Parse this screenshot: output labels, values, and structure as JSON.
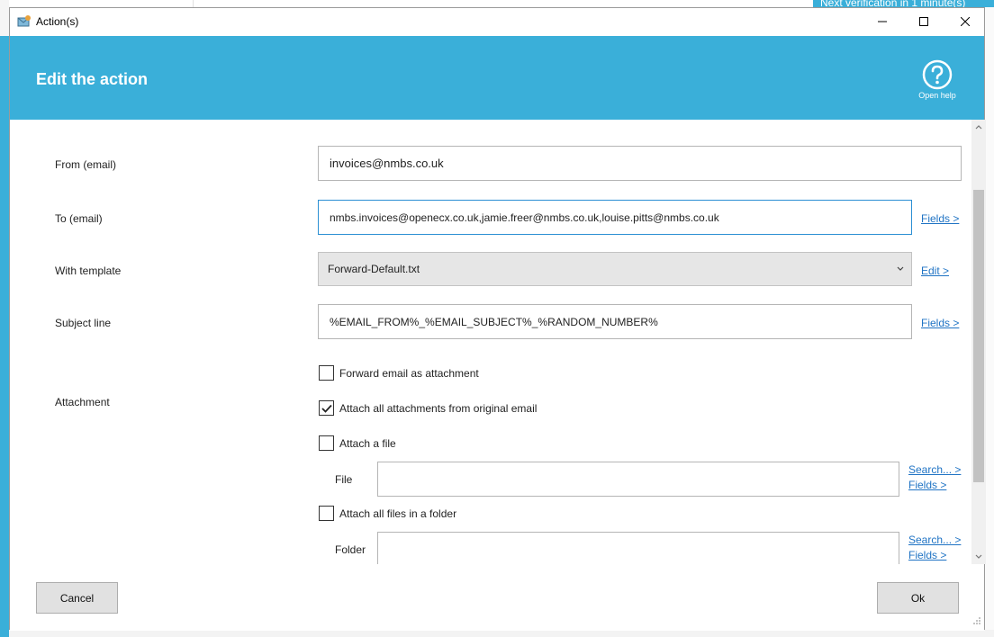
{
  "window": {
    "title": "Action(s)"
  },
  "background": {
    "banner_text": "Next verification in 1 minute(s)"
  },
  "header": {
    "heading": "Edit the action",
    "help_label": "Open help"
  },
  "form": {
    "from_label": "From (email)",
    "from_value": "invoices@nmbs.co.uk",
    "to_label": "To (email)",
    "to_value": "nmbs.invoices@openecx.co.uk,jamie.freer@nmbs.co.uk,louise.pitts@nmbs.co.uk",
    "to_link": "Fields >",
    "template_label": "With template",
    "template_value": "Forward-Default.txt",
    "template_link": "Edit >",
    "subject_label": "Subject line",
    "subject_value": "%EMAIL_FROM%_%EMAIL_SUBJECT%_%RANDOM_NUMBER%",
    "subject_link": "Fields >",
    "attachment_label": "Attachment",
    "forward_as_attachment": {
      "label": "Forward email as attachment",
      "checked": false
    },
    "attach_all_original": {
      "label": "Attach all attachments from original email",
      "checked": true
    },
    "attach_file": {
      "label": "Attach a file",
      "checked": false
    },
    "file_label": "File",
    "file_value": "",
    "file_search_link": "Search... >",
    "file_fields_link": "Fields >",
    "attach_folder": {
      "label": "Attach all files in a folder",
      "checked": false
    },
    "folder_label": "Folder",
    "folder_value": "",
    "folder_search_link": "Search... >",
    "folder_fields_link": "Fields >"
  },
  "footer": {
    "cancel_label": "Cancel",
    "ok_label": "Ok"
  },
  "colors": {
    "accent": "#3aafd9",
    "link": "#1f73c4"
  }
}
